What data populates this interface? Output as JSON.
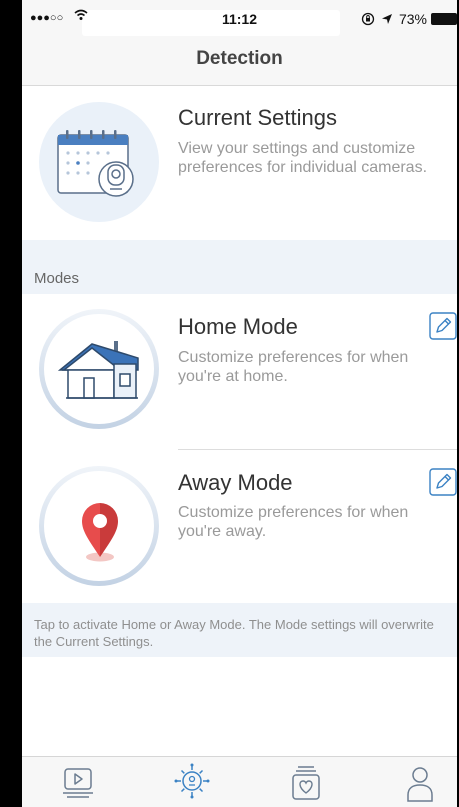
{
  "status_bar": {
    "signal": "●●●○○",
    "time": "11:12",
    "battery": "73%"
  },
  "nav": {
    "title": "Detection"
  },
  "current_settings": {
    "title": "Current Settings",
    "description": "View your settings and customize preferences for individual cameras."
  },
  "modes_section": {
    "label": "Modes"
  },
  "home_mode": {
    "title": "Home Mode",
    "description": "Customize preferences for when you're at home."
  },
  "away_mode": {
    "title": "Away Mode",
    "description": "Customize preferences for when you're away."
  },
  "footer_note": "Tap to activate Home or Away Mode. The Mode settings will overwrite the Current Settings.",
  "tabs": [
    {
      "icon": "live-video-icon"
    },
    {
      "icon": "detection-icon"
    },
    {
      "icon": "memories-icon"
    },
    {
      "icon": "profile-icon"
    }
  ],
  "colors": {
    "accent": "#3b82c4",
    "band": "#eef3f9",
    "pin": "#e74c4c"
  }
}
